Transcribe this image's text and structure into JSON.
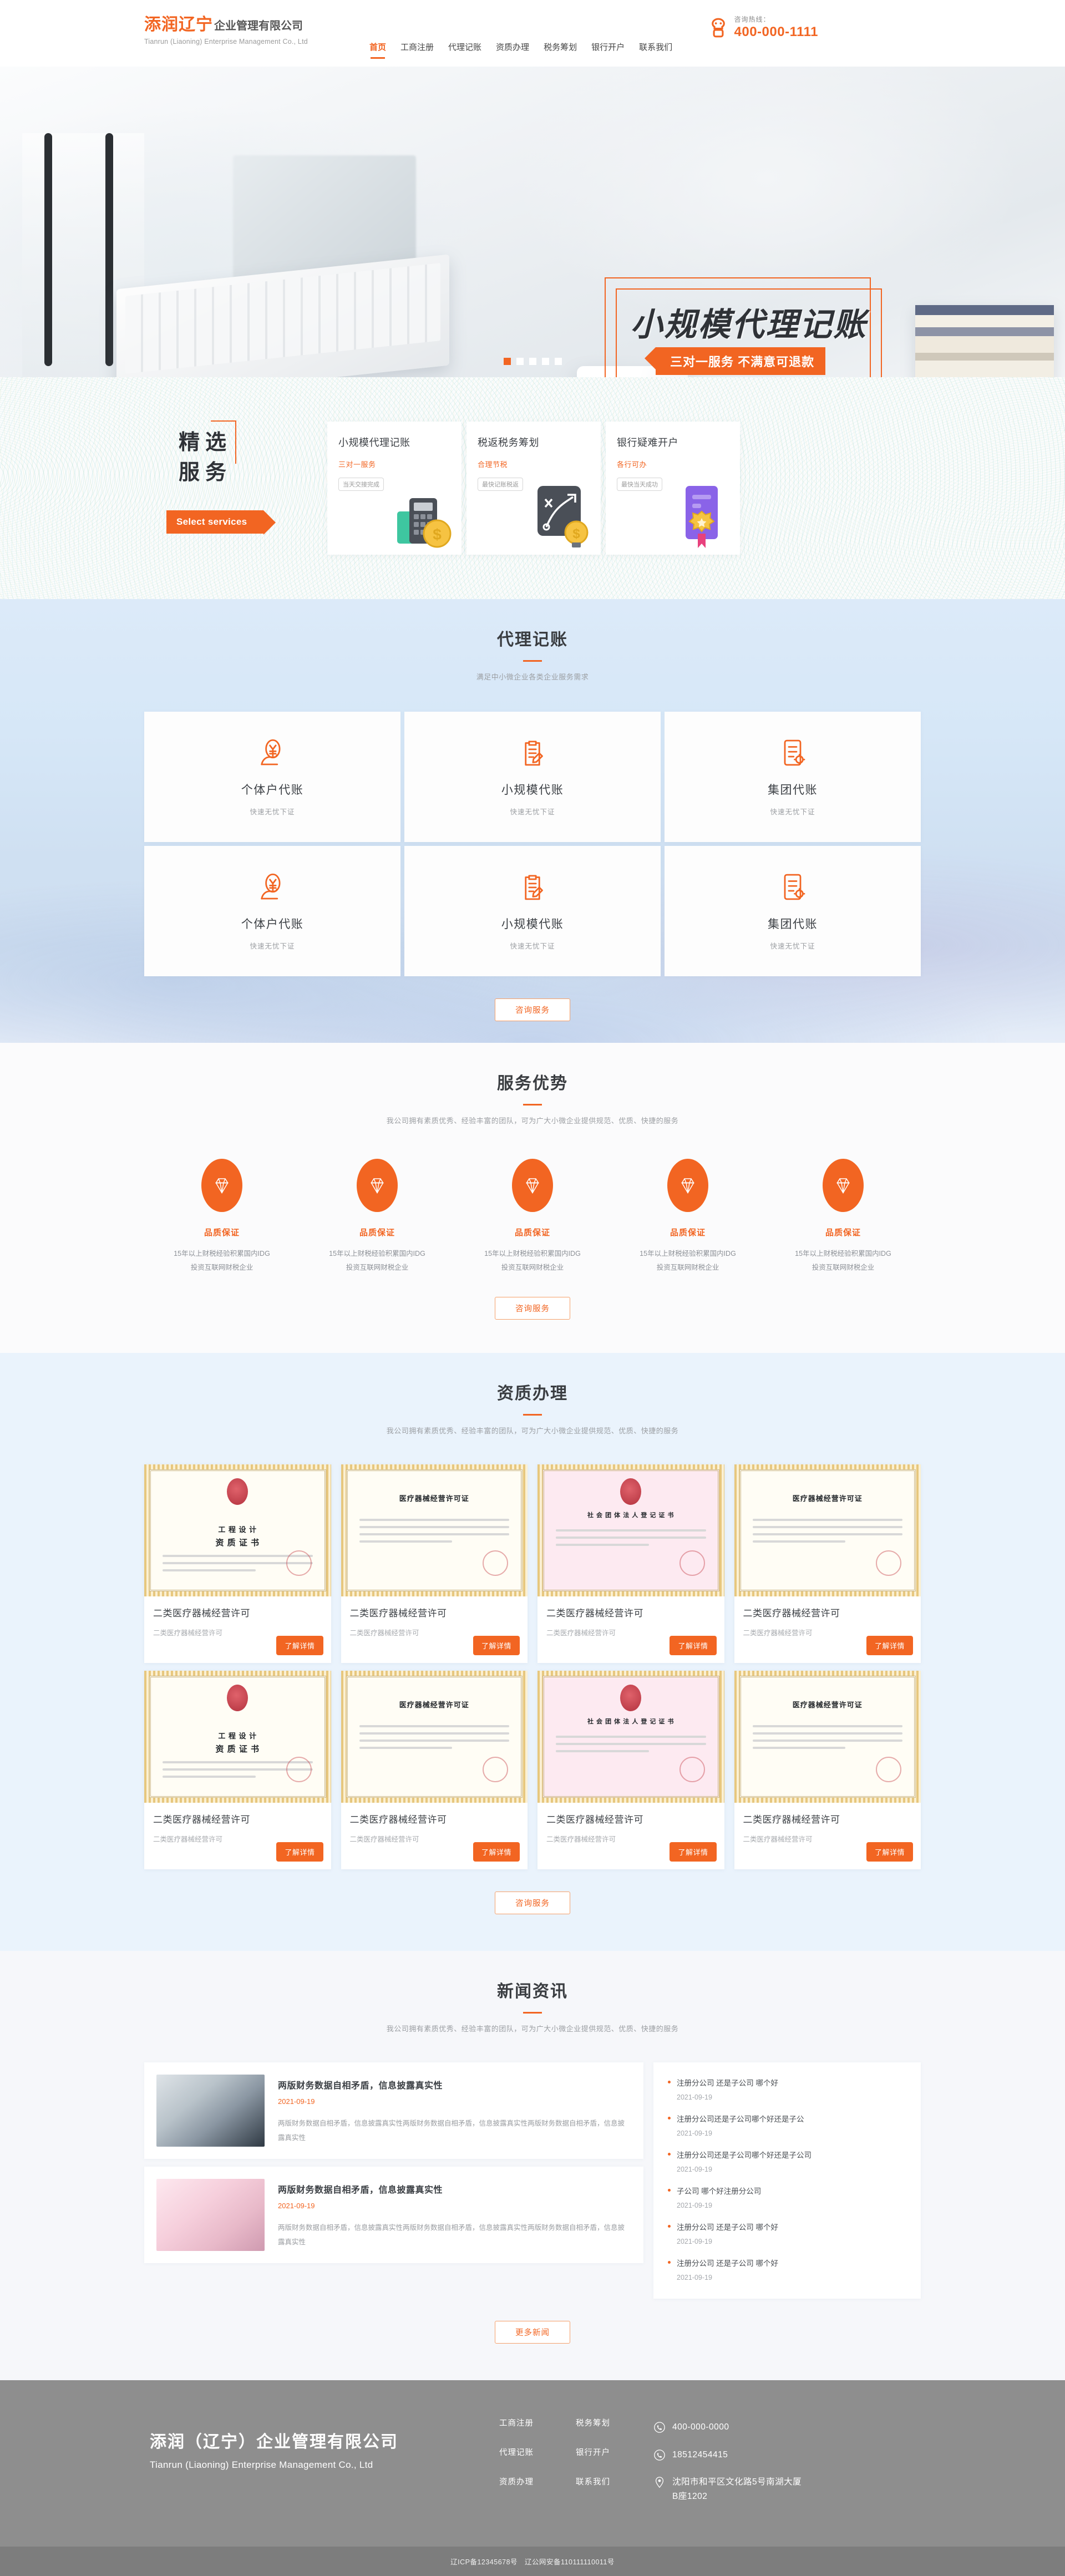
{
  "header": {
    "logo_cn_orange": "添润辽宁",
    "logo_cn_gray": "企业管理有限公司",
    "logo_en": "Tianrun (Liaoning) Enterprise Management Co., Ltd",
    "nav": [
      {
        "label": "首页",
        "active": true
      },
      {
        "label": "工商注册",
        "active": false
      },
      {
        "label": "代理记账",
        "active": false
      },
      {
        "label": "资质办理",
        "active": false
      },
      {
        "label": "税务筹划",
        "active": false
      },
      {
        "label": "银行开户",
        "active": false
      },
      {
        "label": "联系我们",
        "active": false
      }
    ],
    "hotline_label": "咨询热线：",
    "hotline_number": "400-000-1111"
  },
  "hero": {
    "title": "小规模代理记账",
    "subtitle": "三对一服务 不满意可退款",
    "dots": 5,
    "active_dot": 0
  },
  "featured": {
    "title_line1": "精选",
    "title_line2": "服务",
    "ribbon": "Select services",
    "cards": [
      {
        "title": "小规模代理记账",
        "sub": "三对一服务",
        "badge": "当天交接完成",
        "icon": "calculator-coin-icon"
      },
      {
        "title": "税返税务筹划",
        "sub": "合理节税",
        "badge": "最快记账税返",
        "icon": "strategy-bulb-icon"
      },
      {
        "title": "银行疑难开户",
        "sub": "各行可办",
        "badge": "最快当天成功",
        "icon": "certificate-medal-icon"
      }
    ]
  },
  "agency": {
    "title": "代理记账",
    "desc": "满足中小微企业各类企业服务需求",
    "cards": [
      {
        "title": "个体户代账",
        "desc": "快速无忧下证",
        "icon": "hand-yuan-icon"
      },
      {
        "title": "小规模代账",
        "desc": "快速无忧下证",
        "icon": "clipboard-pen-icon"
      },
      {
        "title": "集团代账",
        "desc": "快速无忧下证",
        "icon": "document-gear-icon"
      },
      {
        "title": "个体户代账",
        "desc": "快速无忧下证",
        "icon": "hand-yuan-icon"
      },
      {
        "title": "小规模代账",
        "desc": "快速无忧下证",
        "icon": "clipboard-pen-icon"
      },
      {
        "title": "集团代账",
        "desc": "快速无忧下证",
        "icon": "document-gear-icon"
      }
    ],
    "cta": "咨询服务"
  },
  "advantages": {
    "title": "服务优势",
    "desc": "我公司拥有素质优秀、经验丰富的团队，可为广大小微企业提供规范、优质、快捷的服务",
    "items": [
      {
        "title": "品质保证",
        "desc": "15年以上财税经验积累国内IDG投资互联网财税企业",
        "icon": "diamond-icon"
      },
      {
        "title": "品质保证",
        "desc": "15年以上财税经验积累国内IDG投资互联网财税企业",
        "icon": "diamond-icon"
      },
      {
        "title": "品质保证",
        "desc": "15年以上财税经验积累国内IDG投资互联网财税企业",
        "icon": "diamond-icon"
      },
      {
        "title": "品质保证",
        "desc": "15年以上财税经验积累国内IDG投资互联网财税企业",
        "icon": "diamond-icon"
      },
      {
        "title": "品质保证",
        "desc": "15年以上财税经验积累国内IDG投资互联网财税企业",
        "icon": "diamond-icon"
      }
    ],
    "cta": "咨询服务"
  },
  "qualification": {
    "title": "资质办理",
    "desc": "我公司拥有素质优秀、经验丰富的团队，可为广大小微企业提供规范、优质、快捷的服务",
    "cards": [
      {
        "cert_title": "资 质 证 书",
        "cert_sub": "工 程 设 计",
        "style": "gold",
        "title": "二类医疗器械经营许可",
        "desc": "二类医疗器械经营许可",
        "button": "了解详情"
      },
      {
        "cert_title": "医疗器械经营许可证",
        "cert_sub": "",
        "style": "white",
        "title": "二类医疗器械经营许可",
        "desc": "二类医疗器械经营许可",
        "button": "了解详情"
      },
      {
        "cert_title": "社 会 团 体 法 人 登 记 证 书",
        "cert_sub": "",
        "style": "pink",
        "title": "二类医疗器械经营许可",
        "desc": "二类医疗器械经营许可",
        "button": "了解详情"
      },
      {
        "cert_title": "医疗器械经营许可证",
        "cert_sub": "",
        "style": "white",
        "title": "二类医疗器械经营许可",
        "desc": "二类医疗器械经营许可",
        "button": "了解详情"
      },
      {
        "cert_title": "资 质 证 书",
        "cert_sub": "工 程 设 计",
        "style": "gold",
        "title": "二类医疗器械经营许可",
        "desc": "二类医疗器械经营许可",
        "button": "了解详情"
      },
      {
        "cert_title": "医疗器械经营许可证",
        "cert_sub": "",
        "style": "white",
        "title": "二类医疗器械经营许可",
        "desc": "二类医疗器械经营许可",
        "button": "了解详情"
      },
      {
        "cert_title": "社 会 团 体 法 人 登 记 证 书",
        "cert_sub": "",
        "style": "pink",
        "title": "二类医疗器械经营许可",
        "desc": "二类医疗器械经营许可",
        "button": "了解详情"
      },
      {
        "cert_title": "医疗器械经营许可证",
        "cert_sub": "",
        "style": "white",
        "title": "二类医疗器械经营许可",
        "desc": "二类医疗器械经营许可",
        "button": "了解详情"
      }
    ],
    "cta": "咨询服务"
  },
  "news": {
    "title": "新闻资讯",
    "desc": "我公司拥有素质优秀、经验丰富的团队，可为广大小微企业提供规范、优质、快捷的服务",
    "featured": [
      {
        "title": "两版财务数据自相矛盾，信息披露真实性",
        "date": "2021-09-19",
        "excerpt": "两版财务数据自相矛盾，信息披露真实性两版财务数据自相矛盾，信息披露真实性两版财务数据自相矛盾，信息披露真实性",
        "thumb": "coins-pens-photo"
      },
      {
        "title": "两版财务数据自相矛盾，信息披露真实性",
        "date": "2021-09-19",
        "excerpt": "两版财务数据自相矛盾，信息披露真实性两版财务数据自相矛盾，信息披露真实性两版财务数据自相矛盾，信息披露真实性",
        "thumb": "hand-writing-photo"
      }
    ],
    "list": [
      {
        "title": "注册分公司 还是子公司 哪个好",
        "date": "2021-09-19"
      },
      {
        "title": "注册分公司还是子公司哪个好还是子公",
        "date": "2021-09-19"
      },
      {
        "title": "注册分公司还是子公司哪个好还是子公司",
        "date": "2021-09-19"
      },
      {
        "title": "子公司 哪个好注册分公司",
        "date": "2021-09-19"
      },
      {
        "title": "注册分公司 还是子公司 哪个好",
        "date": "2021-09-19"
      },
      {
        "title": "注册分公司 还是子公司 哪个好",
        "date": "2021-09-19"
      }
    ],
    "cta": "更多新闻"
  },
  "footer": {
    "brand_cn": "添润（辽宁）企业管理有限公司",
    "brand_en": "Tianrun (Liaoning) Enterprise Management Co., Ltd",
    "links_col1": [
      "工商注册",
      "代理记账",
      "资质办理"
    ],
    "links_col2": [
      "税务筹划",
      "银行开户",
      "联系我们"
    ],
    "contacts": [
      {
        "icon": "phone-icon",
        "text": "400-000-0000"
      },
      {
        "icon": "phone-icon",
        "text": "18512454415"
      },
      {
        "icon": "location-pin-icon",
        "text": "沈阳市和平区文化路5号南湖大厦B座1202"
      }
    ],
    "copyright": "辽ICP备12345678号　辽公网安备110111110011号"
  },
  "colors": {
    "accent": "#f26522",
    "text_dark": "#3a3d41",
    "text_muted": "#9b9ea2",
    "footer_bg": "#8e8e8e"
  }
}
